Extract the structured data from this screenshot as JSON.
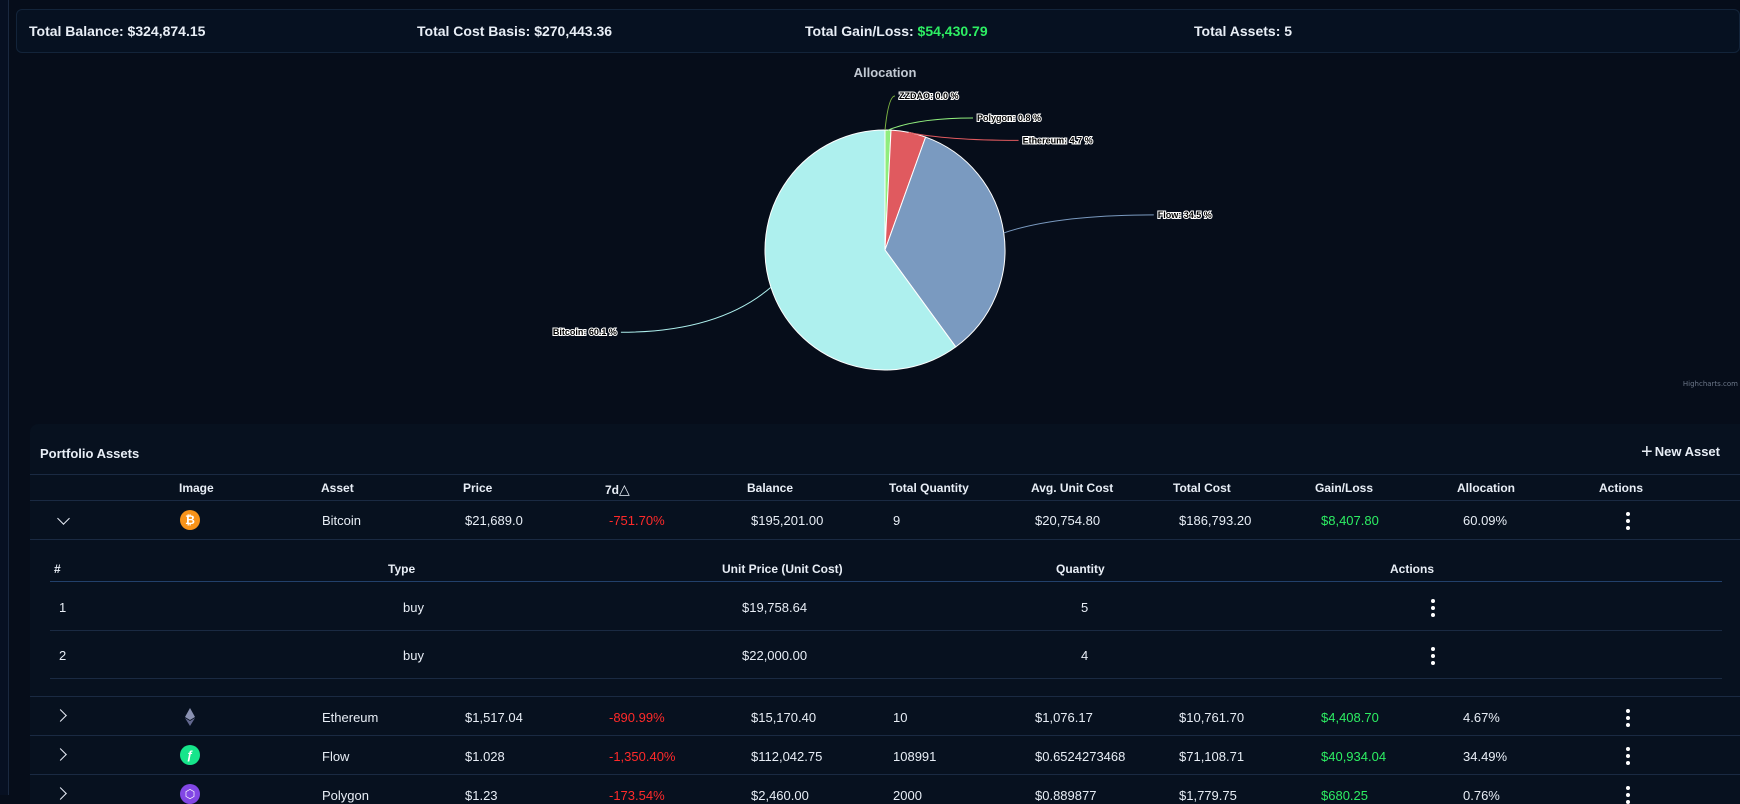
{
  "summary": {
    "balance_label": "Total Balance:",
    "balance_value": "$324,874.15",
    "cost_label": "Total Cost Basis:",
    "cost_value": "$270,443.36",
    "gain_label": "Total Gain/Loss:",
    "gain_value": "$54,430.79",
    "assets_label": "Total Assets:",
    "assets_value": "5"
  },
  "chart_data": {
    "type": "pie",
    "title": "Allocation",
    "credits": "Highcharts.com",
    "slices": [
      {
        "name": "ZZDAO",
        "value": 0.0,
        "label": "ZZDAO: 0.0 %",
        "color": "#7cb342"
      },
      {
        "name": "Polygon",
        "value": 0.8,
        "label": "Polygon: 0.8 %",
        "color": "#90ed7d"
      },
      {
        "name": "Ethereum",
        "value": 4.7,
        "label": "Ethereum: 4.7 %",
        "color": "#e05a5f"
      },
      {
        "name": "Flow",
        "value": 34.5,
        "label": "Flow: 34.5 %",
        "color": "#7a9ac0"
      },
      {
        "name": "Bitcoin",
        "value": 60.1,
        "label": "Bitcoin: 60.1 %",
        "color": "#aef0ee"
      }
    ]
  },
  "panel": {
    "title": "Portfolio Assets",
    "new_asset_label": "New Asset",
    "columns": [
      "Image",
      "Asset",
      "Price",
      "7d",
      "Balance",
      "Total Quantity",
      "Avg. Unit Cost",
      "Total Cost",
      "Gain/Loss",
      "Allocation",
      "Actions"
    ],
    "delta_symbol": "△"
  },
  "assets": [
    {
      "name": "Bitcoin",
      "icon": "bitcoin-icon",
      "price": "$21,689.0",
      "change": "-751.70%",
      "balance": "$195,201.00",
      "quantity": "9",
      "avg_cost": "$20,754.80",
      "total_cost": "$186,793.20",
      "gain": "$8,407.80",
      "allocation": "60.09%"
    },
    {
      "name": "Ethereum",
      "icon": "ethereum-icon",
      "price": "$1,517.04",
      "change": "-890.99%",
      "balance": "$15,170.40",
      "quantity": "10",
      "avg_cost": "$1,076.17",
      "total_cost": "$10,761.70",
      "gain": "$4,408.70",
      "allocation": "4.67%"
    },
    {
      "name": "Flow",
      "icon": "flow-icon",
      "price": "$1.028",
      "change": "-1,350.40%",
      "balance": "$112,042.75",
      "quantity": "108991",
      "avg_cost": "$0.6524273468",
      "total_cost": "$71,108.71",
      "gain": "$40,934.04",
      "allocation": "34.49%"
    },
    {
      "name": "Polygon",
      "icon": "polygon-icon",
      "price": "$1.23",
      "change": "-173.54%",
      "balance": "$2,460.00",
      "quantity": "2000",
      "avg_cost": "$0.889877",
      "total_cost": "$1,779.75",
      "gain": "$680.25",
      "allocation": "0.76%"
    }
  ],
  "transactions": {
    "columns": [
      "#",
      "Type",
      "Unit Price (Unit Cost)",
      "Quantity",
      "Actions"
    ],
    "rows": [
      {
        "num": "1",
        "type": "buy",
        "unit_price": "$19,758.64",
        "quantity": "5"
      },
      {
        "num": "2",
        "type": "buy",
        "unit_price": "$22,000.00",
        "quantity": "4"
      }
    ]
  }
}
